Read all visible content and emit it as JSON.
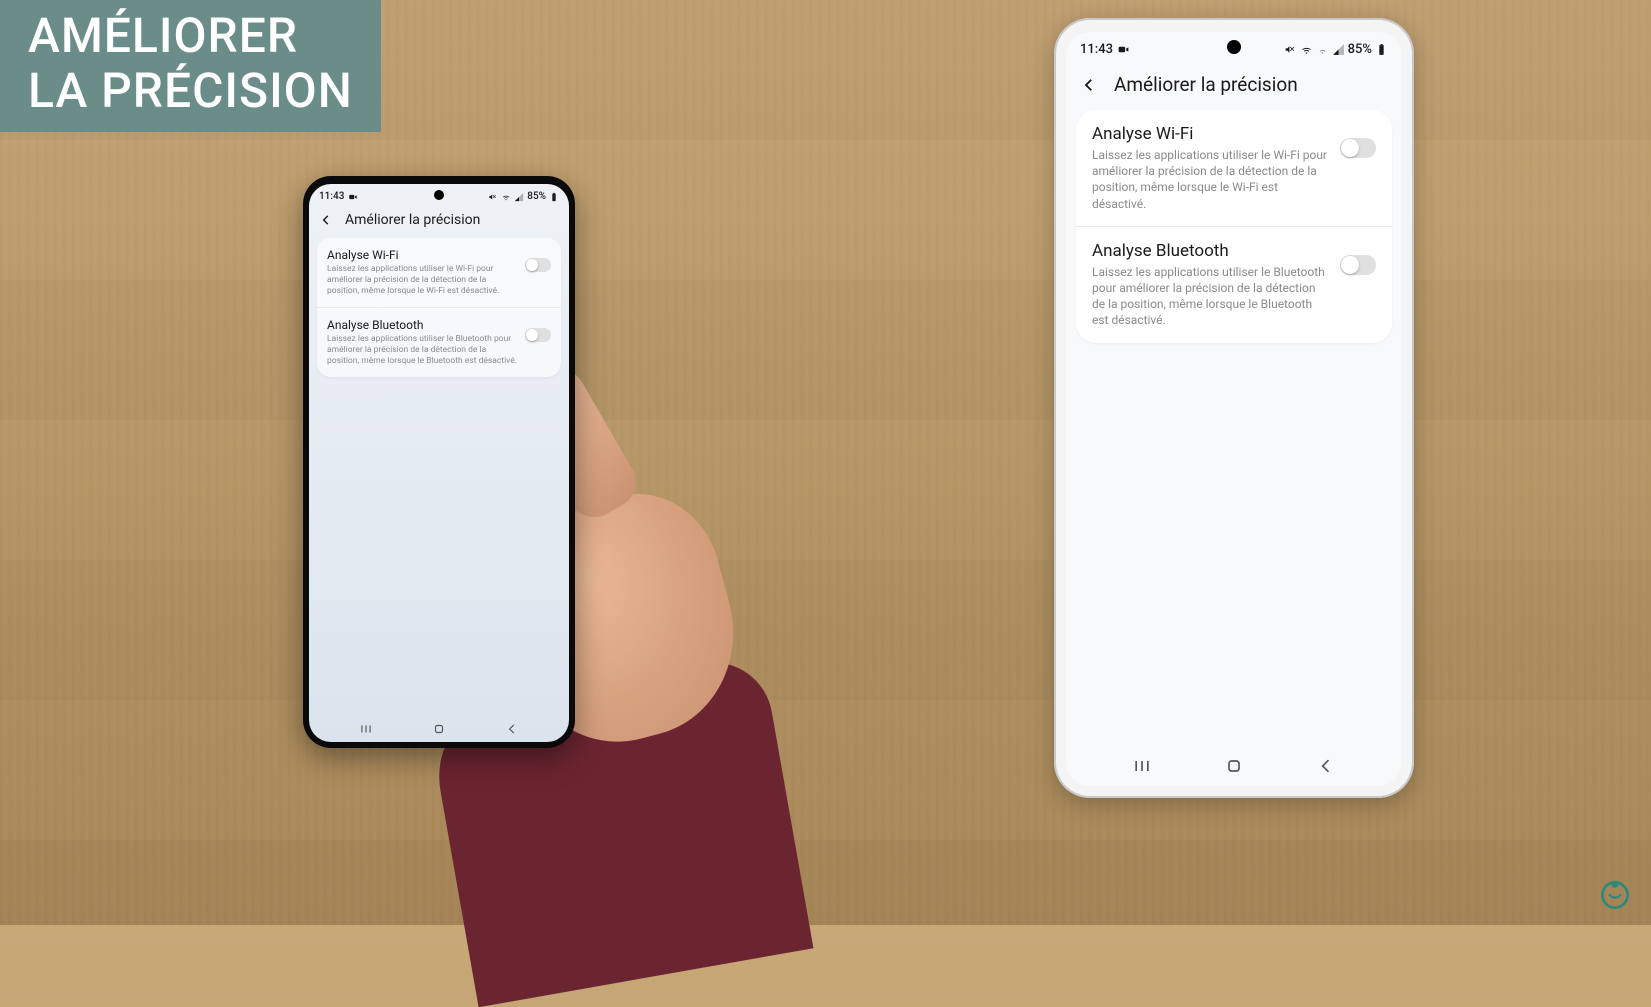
{
  "overlay": {
    "line1": "AMÉLIORER",
    "line2": "LA PRÉCISION"
  },
  "status": {
    "time": "11:43",
    "battery": "85%"
  },
  "app": {
    "title": "Améliorer la précision"
  },
  "settings": {
    "wifi": {
      "title": "Analyse Wi-Fi",
      "desc": "Laissez les applications utiliser le Wi-Fi pour améliorer la précision de la détection de la position, même lorsque le Wi-Fi est désactivé.",
      "enabled": false
    },
    "bluetooth": {
      "title": "Analyse Bluetooth",
      "desc": "Laissez les applications utiliser le Bluetooth pour améliorer la précision de la détection de la position, même lorsque le Bluetooth est désactivé.",
      "enabled": false
    }
  }
}
